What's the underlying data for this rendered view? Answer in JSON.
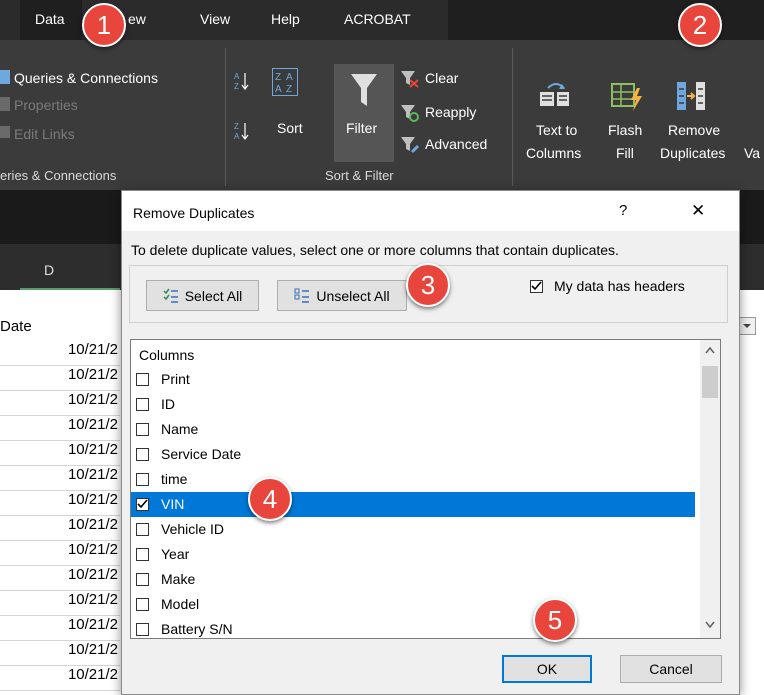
{
  "ribbon": {
    "tabs": [
      "Data",
      "Review",
      "View",
      "Help",
      "ACROBAT"
    ],
    "tab_partial_review": "ew",
    "queries": {
      "queries_connections": "Queries & Connections",
      "properties": "Properties",
      "edit_links": "Edit Links",
      "group_label": "eries & Connections"
    },
    "sort_filter": {
      "sort": "Sort",
      "filter": "Filter",
      "clear": "Clear",
      "reapply": "Reapply",
      "advanced": "Advanced",
      "group_label": "Sort & Filter"
    },
    "data_tools": {
      "text_to": "Text to",
      "columns": "Columns",
      "flash": "Flash",
      "fill": "Fill",
      "remove": "Remove",
      "duplicates": "Duplicates",
      "va_partial": "Va"
    }
  },
  "sheet": {
    "column_letter": "D",
    "header_label": "Date",
    "cells": [
      "10/21/2",
      "10/21/2",
      "10/21/2",
      "10/21/2",
      "10/21/2",
      "10/21/2",
      "10/21/2",
      "10/21/2",
      "10/21/2",
      "10/21/2",
      "10/21/2",
      "10/21/2",
      "10/21/2",
      "10/21/2"
    ]
  },
  "dialog": {
    "title": "Remove Duplicates",
    "help": "?",
    "close": "✕",
    "instruction": "To delete duplicate values, select one or more columns that contain duplicates.",
    "select_all": "Select All",
    "unselect_all": "Unselect All",
    "my_data_headers": "My data has headers",
    "my_data_headers_checked": true,
    "columns_header": "Columns",
    "columns": [
      {
        "label": "Print",
        "checked": false
      },
      {
        "label": "ID",
        "checked": false
      },
      {
        "label": "Name",
        "checked": false
      },
      {
        "label": "Service Date",
        "checked": false
      },
      {
        "label": "time",
        "checked": false
      },
      {
        "label": "VIN",
        "checked": true,
        "selected": true
      },
      {
        "label": "Vehicle ID",
        "checked": false
      },
      {
        "label": "Year",
        "checked": false
      },
      {
        "label": "Make",
        "checked": false
      },
      {
        "label": "Model",
        "checked": false
      },
      {
        "label": "Battery S/N",
        "checked": false
      }
    ],
    "ok": "OK",
    "cancel": "Cancel"
  },
  "badges": [
    "1",
    "2",
    "3",
    "4",
    "5"
  ],
  "colors": {
    "badge": "#e8453c",
    "selection": "#0078d7",
    "ribbon": "#3b3b3b"
  }
}
